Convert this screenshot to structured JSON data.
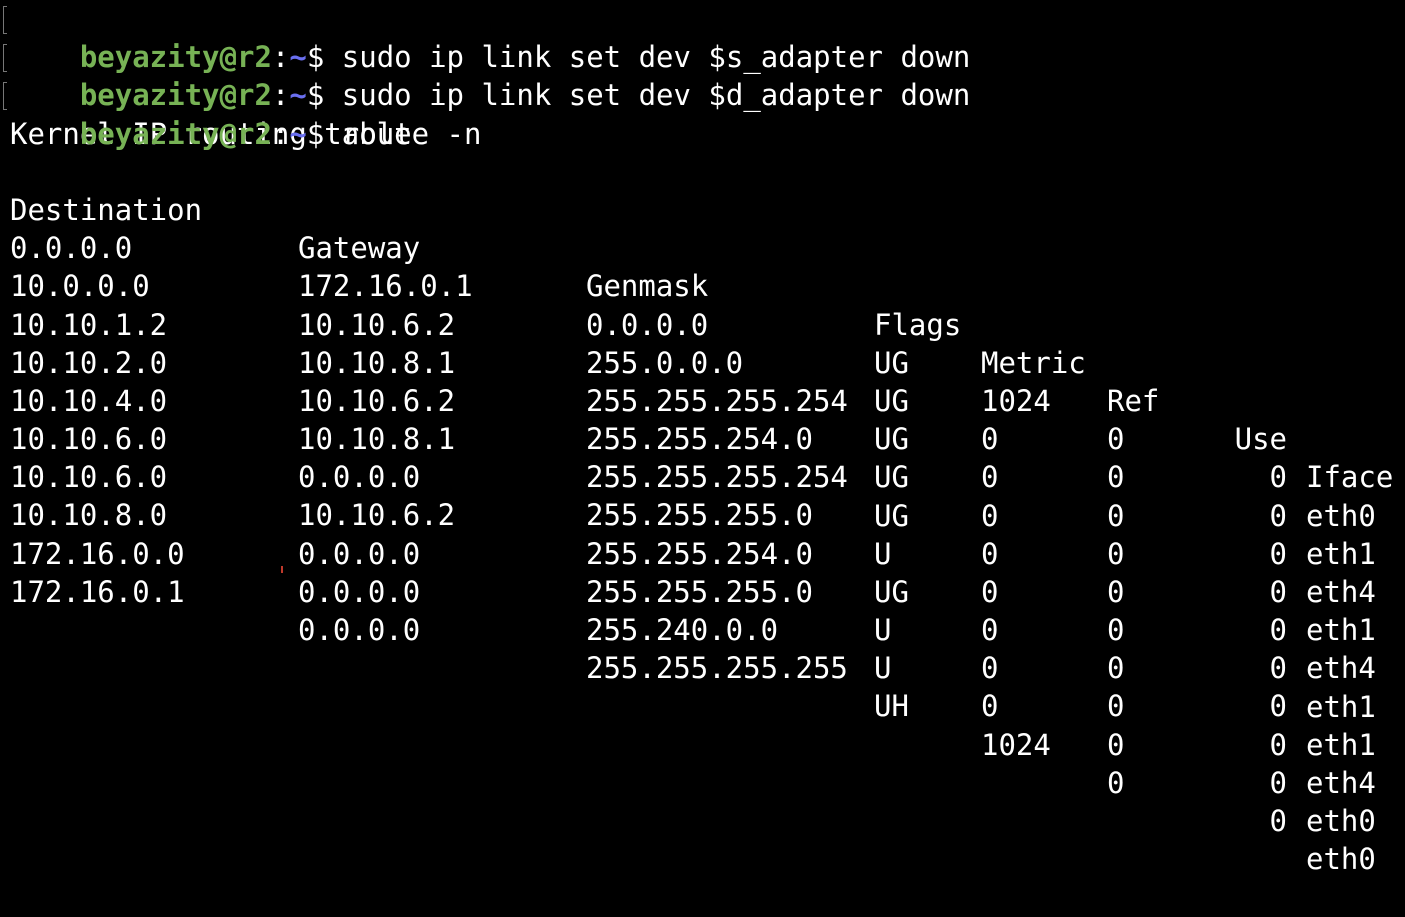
{
  "prompt": {
    "user_host": "beyazity@r2",
    "colon": ":",
    "path": "~",
    "symbol": "$"
  },
  "commands": [
    " sudo ip link set dev $s_adapter down",
    " sudo ip link set dev $d_adapter down",
    " route -n"
  ],
  "output_title": "Kernel IP routing table",
  "table": {
    "headers": [
      "Destination",
      "Gateway",
      "Genmask",
      "Flags",
      "Metric",
      "Ref",
      "Use",
      "Iface"
    ],
    "rows": [
      [
        "0.0.0.0",
        "172.16.0.1",
        "0.0.0.0",
        "UG",
        "1024",
        "0",
        "0",
        "eth0"
      ],
      [
        "10.0.0.0",
        "10.10.6.2",
        "255.0.0.0",
        "UG",
        "0",
        "0",
        "0",
        "eth1"
      ],
      [
        "10.10.1.2",
        "10.10.8.1",
        "255.255.255.254",
        "UG",
        "0",
        "0",
        "0",
        "eth4"
      ],
      [
        "10.10.2.0",
        "10.10.6.2",
        "255.255.254.0",
        "UG",
        "0",
        "0",
        "0",
        "eth1"
      ],
      [
        "10.10.4.0",
        "10.10.8.1",
        "255.255.255.254",
        "UG",
        "0",
        "0",
        "0",
        "eth4"
      ],
      [
        "10.10.6.0",
        "0.0.0.0",
        "255.255.255.0",
        "U",
        "0",
        "0",
        "0",
        "eth1"
      ],
      [
        "10.10.6.0",
        "10.10.6.2",
        "255.255.254.0",
        "UG",
        "0",
        "0",
        "0",
        "eth1"
      ],
      [
        "10.10.8.0",
        "0.0.0.0",
        "255.255.255.0",
        "U",
        "0",
        "0",
        "0",
        "eth4"
      ],
      [
        "172.16.0.0",
        "0.0.0.0",
        "255.240.0.0",
        "U",
        "0",
        "0",
        "0",
        "eth0"
      ],
      [
        "172.16.0.1",
        "0.0.0.0",
        "255.255.255.255",
        "UH",
        "1024",
        "0",
        "0",
        "eth0"
      ]
    ]
  },
  "colors": {
    "background": "#000000",
    "user_host": "#77b255",
    "path": "#6a6ff0",
    "text": "#ffffff"
  }
}
